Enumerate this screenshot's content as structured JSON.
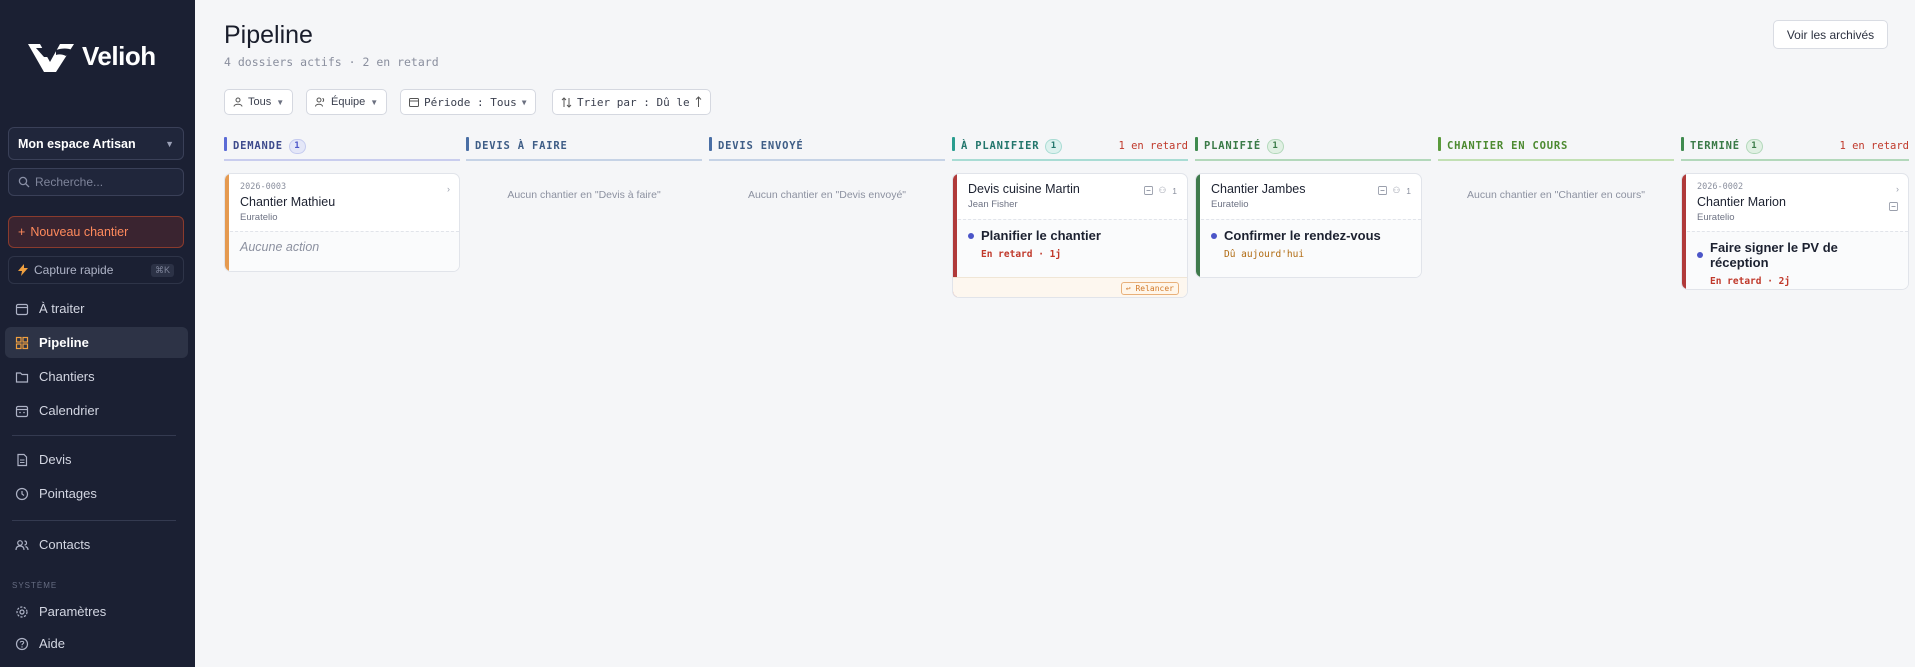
{
  "app": {
    "brand": "Velioh",
    "workspace": "Mon espace Artisan",
    "search_placeholder": "Recherche...",
    "new_site": "Nouveau chantier",
    "quick_capture": "Capture rapide",
    "quick_capture_shortcut": "⌘K",
    "nav": [
      {
        "label": "À traiter",
        "icon": "calendar-check-icon"
      },
      {
        "label": "Pipeline",
        "icon": "pipeline-icon",
        "active": true
      },
      {
        "label": "Chantiers",
        "icon": "folder-icon"
      },
      {
        "label": "Calendrier",
        "icon": "calendar-icon"
      },
      {
        "label": "Devis",
        "icon": "document-icon"
      },
      {
        "label": "Pointages",
        "icon": "clock-icon"
      },
      {
        "label": "Contacts",
        "icon": "users-icon"
      }
    ],
    "system_label": "SYSTÈME",
    "system_nav": [
      {
        "label": "Paramètres",
        "icon": "gear-icon"
      },
      {
        "label": "Aide",
        "icon": "help-icon"
      }
    ]
  },
  "page": {
    "title": "Pipeline",
    "subtitle": "4 dossiers actifs · 2 en retard",
    "archive_button": "Voir les archivés",
    "filters": {
      "person": "Tous",
      "team": "Équipe",
      "period": "Période : Tous",
      "sort": "Trier par : Dû le"
    }
  },
  "columns": [
    {
      "title": "DEMANDE",
      "count": "1",
      "color": "#5b6bd6"
    },
    {
      "title": "DEVIS À FAIRE",
      "empty": "Aucun chantier en \"Devis à faire\"",
      "color": "#4a6fa5"
    },
    {
      "title": "DEVIS ENVOYÉ",
      "empty": "Aucun chantier en \"Devis envoyé\"",
      "color": "#4a6fa5"
    },
    {
      "title": "À PLANIFIER",
      "count": "1",
      "late": "1 en retard",
      "color": "#2a9d8f"
    },
    {
      "title": "PLANIFIÉ",
      "count": "1",
      "color": "#3f8a4f"
    },
    {
      "title": "CHANTIER EN COURS",
      "empty": "Aucun chantier en \"Chantier en cours\"",
      "color": "#5a9a3c"
    },
    {
      "title": "TERMINÉ",
      "count": "1",
      "late": "1 en retard",
      "color": "#3f8a4f"
    }
  ],
  "cards": {
    "mathieu": {
      "ref": "2026-0003",
      "name": "Chantier Mathieu",
      "client": "Euratelio",
      "action": "Aucune action"
    },
    "martin": {
      "name": "Devis cuisine Martin",
      "client": "Jean Fisher",
      "people": "1",
      "task": "Planifier le chantier",
      "due": "En retard · 1j",
      "relaunch": "↩ Relancer"
    },
    "jambes": {
      "name": "Chantier Jambes",
      "client": "Euratelio",
      "people": "1",
      "task": "Confirmer le rendez-vous",
      "due": "Dû aujourd'hui"
    },
    "marion": {
      "ref": "2026-0002",
      "name": "Chantier Marion",
      "client": "Euratelio",
      "task": "Faire signer le PV de réception",
      "due": "En retard · 2j"
    }
  }
}
